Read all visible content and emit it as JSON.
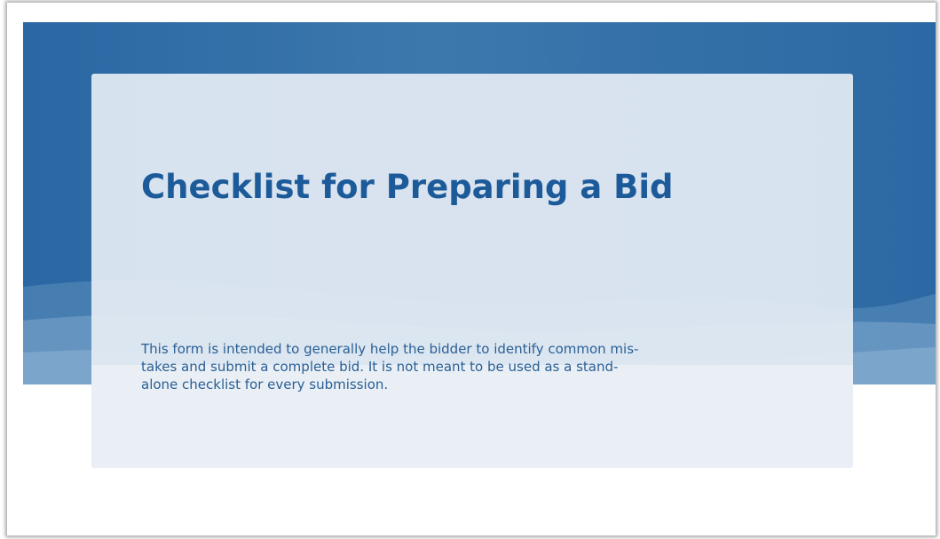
{
  "slide": {
    "title": "Checklist for Preparing a Bid",
    "description_lines": [
      "This form is intended to generally help the bidder to identify common mis-",
      "takes and submit a complete bid. It is not meant to be used as a stand-",
      "alone checklist for every submission."
    ]
  },
  "colors": {
    "banner": "#3672a9",
    "title": "#1c5a9a",
    "text": "#2a5f94",
    "card": "#e4ecf4"
  }
}
